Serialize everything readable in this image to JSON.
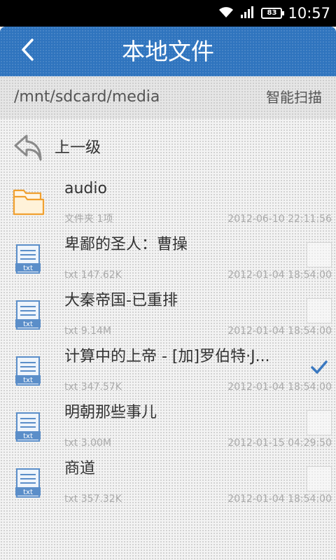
{
  "status_bar": {
    "battery": "83",
    "time": "10:57"
  },
  "header": {
    "title": "本地文件"
  },
  "path_bar": {
    "path": "/mnt/sdcard/media",
    "scan_label": "智能扫描"
  },
  "up_row": {
    "label": "上一级"
  },
  "items": [
    {
      "name": "audio",
      "type": "文件夹 1项",
      "date": "2012-06-10 22:11:56",
      "kind": "folder",
      "checked": false
    },
    {
      "name": "卑鄙的圣人：曹操",
      "type": "txt 147.62K",
      "date": "2012-01-04 18:54:00",
      "kind": "txt",
      "checked": false
    },
    {
      "name": "大秦帝国-已重排",
      "type": "txt 9.14M",
      "date": "2012-01-04 18:54:00",
      "kind": "txt",
      "checked": false
    },
    {
      "name": "计算中的上帝 - [加]罗伯特·J...",
      "type": "txt 347.57K",
      "date": "2012-01-04 18:54:00",
      "kind": "txt",
      "checked": true
    },
    {
      "name": "明朝那些事儿",
      "type": "txt 3.00M",
      "date": "2012-01-15 04:29:50",
      "kind": "txt",
      "checked": false
    },
    {
      "name": "商道",
      "type": "txt 357.32K",
      "date": "2012-01-04 18:54:00",
      "kind": "txt",
      "checked": false
    }
  ],
  "colors": {
    "header": "#2f74be",
    "folder": "#f0a030",
    "file": "#5b8ec9",
    "check": "#3a78c0"
  },
  "icons": {
    "back": "chevron-left-icon",
    "up": "undo-arrow-icon",
    "folder": "folder-icon",
    "file": "txt-file-icon",
    "check": "checkmark-icon"
  }
}
